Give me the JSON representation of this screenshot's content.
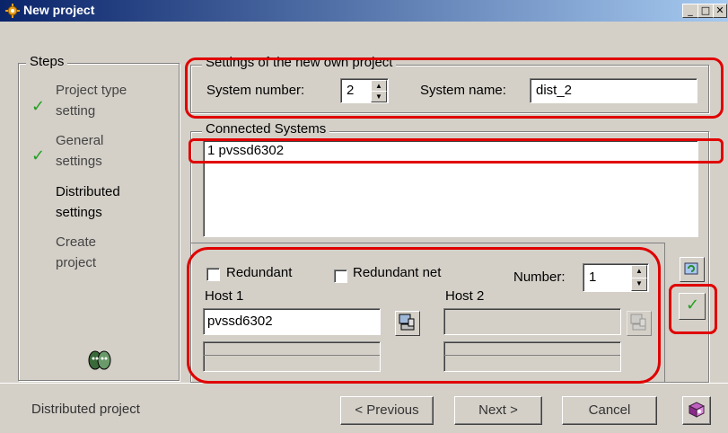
{
  "window": {
    "title": "New project"
  },
  "steps": {
    "title": "Steps",
    "items": [
      {
        "label": "Project type setting",
        "line1": "Project type",
        "line2": "setting",
        "done": true
      },
      {
        "label": "General settings",
        "line1": "General",
        "line2": "settings",
        "done": true
      },
      {
        "label": "Distributed settings",
        "line1": "Distributed",
        "line2": "settings",
        "done": false
      },
      {
        "label": "Create project",
        "line1": "Create",
        "line2": "project",
        "done": false
      }
    ]
  },
  "own_project": {
    "title": "Settings of the new own project",
    "system_number_label": "System number:",
    "system_number_value": "2",
    "system_name_label": "System name:",
    "system_name_value": "dist_2"
  },
  "connected": {
    "title": "Connected Systems",
    "systems": [
      "1 pvssd6302"
    ]
  },
  "redundancy": {
    "redundant_label": "Redundant",
    "redundant_net_label": "Redundant net",
    "number_label": "Number:",
    "number_value": "1",
    "host1_label": "Host 1",
    "host1_value": "pvssd6302",
    "host2_label": "Host 2",
    "host2_value": ""
  },
  "footer": {
    "status": "Distributed project",
    "previous": "< Previous",
    "next": "Next >",
    "cancel": "Cancel"
  },
  "colors": {
    "highlight": "#e00000",
    "check": "#22a022",
    "titlebar": "#0a246a"
  }
}
